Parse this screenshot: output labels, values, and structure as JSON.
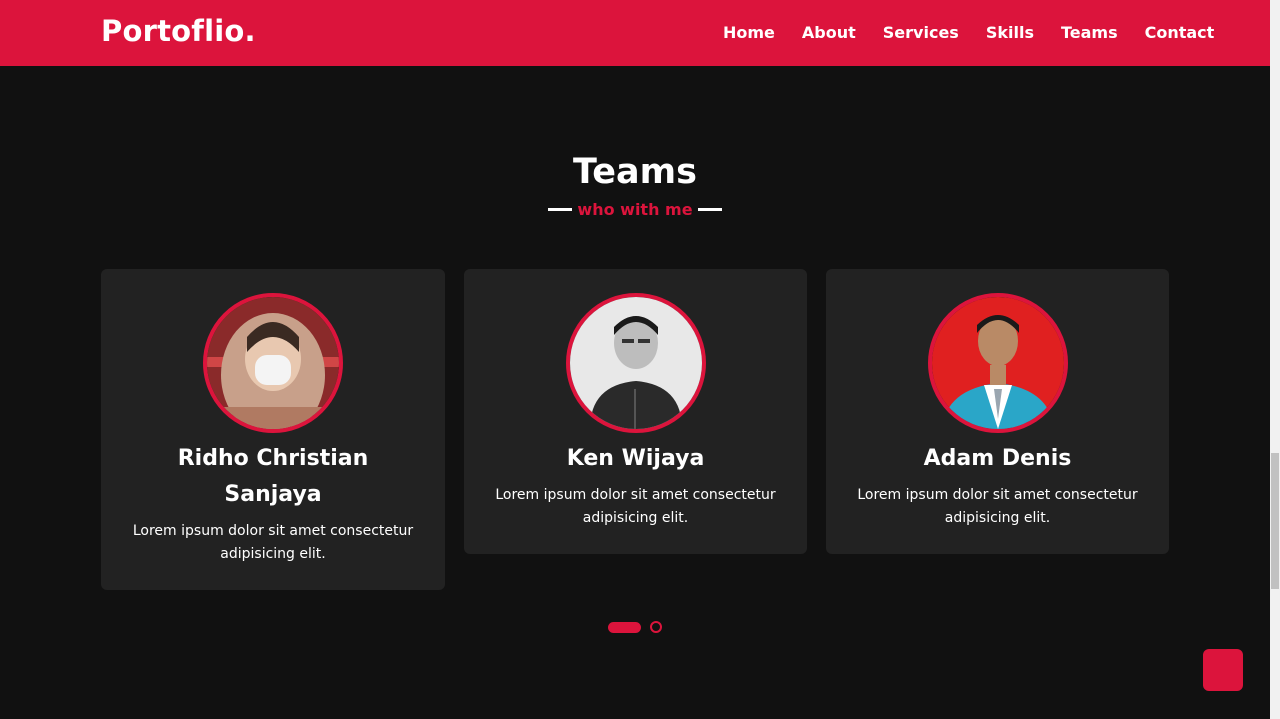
{
  "brand": {
    "logo_text": "Portoflio."
  },
  "nav": {
    "items": [
      {
        "label": "Home"
      },
      {
        "label": "About"
      },
      {
        "label": "Services"
      },
      {
        "label": "Skills"
      },
      {
        "label": "Teams"
      },
      {
        "label": "Contact"
      }
    ]
  },
  "teams": {
    "title": "Teams",
    "subtitle": "who with me",
    "members": [
      {
        "name": "Ridho Christian Sanjaya",
        "description": "Lorem ipsum dolor sit amet consectetur adipisicing elit.",
        "avatar": "person-hood-mask-photo"
      },
      {
        "name": "Ken Wijaya",
        "description": "Lorem ipsum dolor sit amet consectetur adipisicing elit.",
        "avatar": "person-black-white-photo"
      },
      {
        "name": "Adam Denis",
        "description": "Lorem ipsum dolor sit amet consectetur adipisicing elit.",
        "avatar": "person-formal-red-bg-photo"
      }
    ],
    "carousel": {
      "pages": 2,
      "active_page": 1
    }
  },
  "colors": {
    "accent": "#dc143c",
    "background": "#111111",
    "card": "#222222",
    "text": "#ffffff"
  },
  "icons": {
    "scroll_top": "scroll-to-top-icon"
  }
}
